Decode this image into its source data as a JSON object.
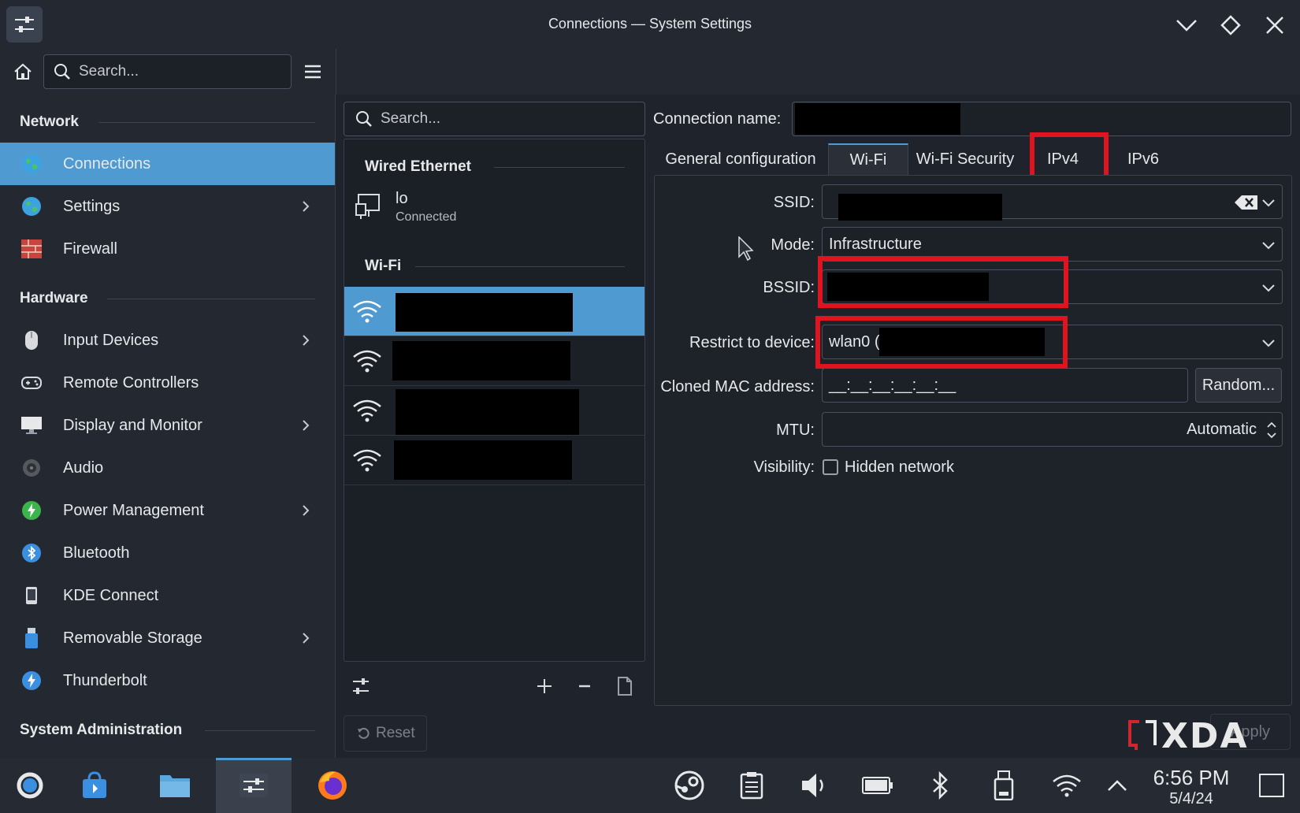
{
  "window": {
    "title": "Connections — System Settings"
  },
  "toolbar": {
    "search_placeholder": "Search..."
  },
  "sidebar": {
    "sections": [
      {
        "heading": "Network"
      },
      {
        "heading": "Hardware"
      },
      {
        "heading": "System Administration"
      }
    ],
    "items": [
      {
        "label": "Connections",
        "icon": "globe-icon",
        "active": true,
        "has_chevron": false
      },
      {
        "label": "Settings",
        "icon": "globe-icon",
        "has_chevron": true
      },
      {
        "label": "Firewall",
        "icon": "firewall-icon",
        "has_chevron": false
      },
      {
        "label": "Input Devices",
        "icon": "mouse-icon",
        "has_chevron": true
      },
      {
        "label": "Remote Controllers",
        "icon": "gamepad-icon",
        "has_chevron": false
      },
      {
        "label": "Display and Monitor",
        "icon": "monitor-icon",
        "has_chevron": true
      },
      {
        "label": "Audio",
        "icon": "speaker-icon",
        "has_chevron": false
      },
      {
        "label": "Power Management",
        "icon": "power-icon",
        "has_chevron": true
      },
      {
        "label": "Bluetooth",
        "icon": "bluetooth-icon",
        "has_chevron": false
      },
      {
        "label": "KDE Connect",
        "icon": "phone-icon",
        "has_chevron": false
      },
      {
        "label": "Removable Storage",
        "icon": "usb-drive-icon",
        "has_chevron": true
      },
      {
        "label": "Thunderbolt",
        "icon": "thunderbolt-icon",
        "has_chevron": false
      }
    ]
  },
  "connections_list": {
    "search_placeholder": "Search...",
    "wired_heading": "Wired Ethernet",
    "wired_item": {
      "name": "lo",
      "status": "Connected"
    },
    "wifi_heading": "Wi-Fi",
    "reset_label": "Reset"
  },
  "details": {
    "connection_name_label": "Connection name:",
    "tabs": [
      "General configuration",
      "Wi-Fi",
      "Wi-Fi Security",
      "IPv4",
      "IPv6"
    ],
    "active_tab": "Wi-Fi",
    "ssid_label": "SSID:",
    "mode_label": "Mode:",
    "mode_value": "Infrastructure",
    "bssid_label": "BSSID:",
    "restrict_label": "Restrict to device:",
    "restrict_value": "wlan0 (",
    "cloned_mac_label": "Cloned MAC address:",
    "cloned_mac_value": "__:__:__:__:__:__",
    "random_label": "Random...",
    "mtu_label": "MTU:",
    "mtu_value": "Automatic",
    "visibility_label": "Visibility:",
    "hidden_network_label": "Hidden network",
    "apply_label": "Apply"
  },
  "watermark": {
    "text": "XDA"
  },
  "taskbar": {
    "time": "6:56 PM",
    "date": "5/4/24"
  },
  "colors": {
    "accent": "#4f9ad0",
    "highlight": "#e0141e",
    "background": "#1f232b"
  }
}
